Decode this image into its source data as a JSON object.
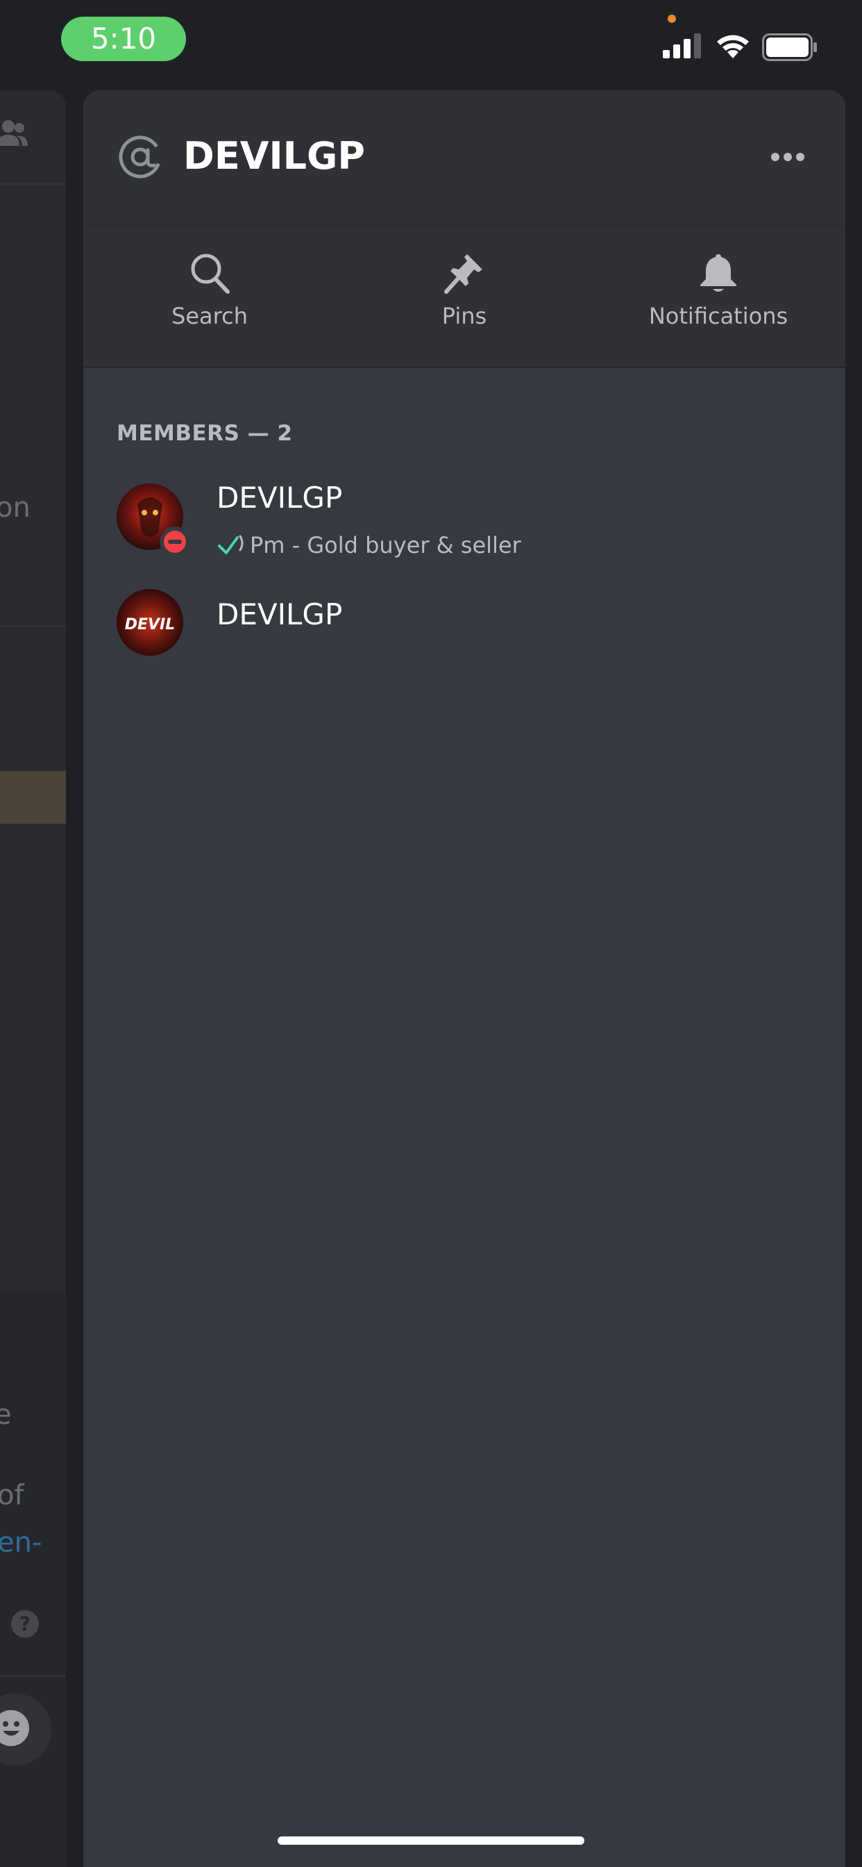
{
  "status_bar": {
    "time": "5:10"
  },
  "background": {
    "fragments": [
      "on",
      "e",
      "of",
      "en-"
    ],
    "help": "?"
  },
  "header": {
    "title": "DEVILGP"
  },
  "toolbar": {
    "search": "Search",
    "pins": "Pins",
    "notifications": "Notifications"
  },
  "members": {
    "header": "MEMBERS — 2",
    "items": [
      {
        "name": "DEVILGP",
        "status_text": "Pm - Gold buyer & seller",
        "presence": "do-not-disturb"
      },
      {
        "name": "DEVILGP",
        "avatar_text": "DEVIL"
      }
    ]
  },
  "colors": {
    "sheet_bg": "#36393f",
    "header_bg": "#2f3136",
    "time_pill": "#5fcf6d",
    "dnd": "#ed4245",
    "link": "#3b8fd1"
  }
}
